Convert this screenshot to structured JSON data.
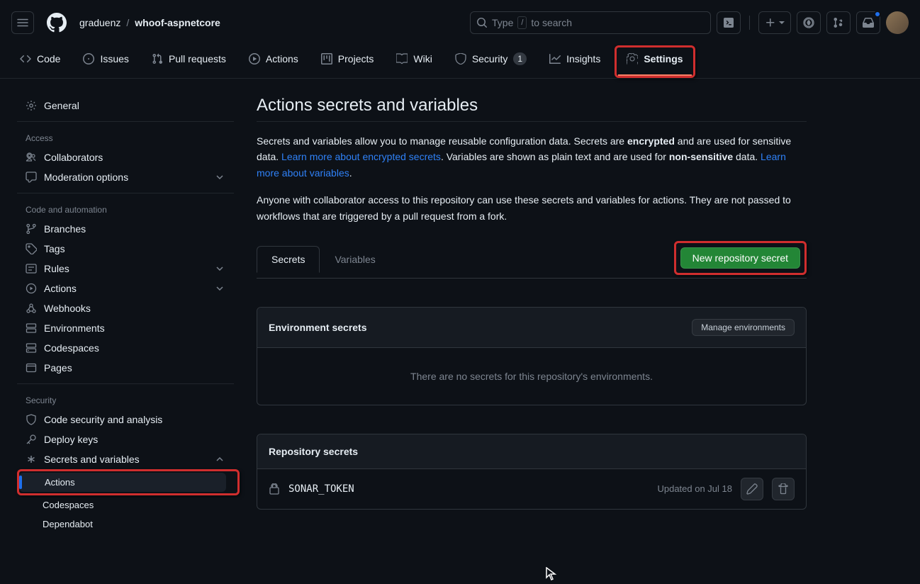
{
  "breadcrumb": {
    "owner": "graduenz",
    "repo": "whoof-aspnetcore"
  },
  "search": {
    "prefix": "Type",
    "key": "/",
    "suffix": "to search"
  },
  "repoNav": {
    "code": "Code",
    "issues": "Issues",
    "pulls": "Pull requests",
    "actions": "Actions",
    "projects": "Projects",
    "wiki": "Wiki",
    "security": "Security",
    "securityCount": "1",
    "insights": "Insights",
    "settings": "Settings"
  },
  "sidebar": {
    "general": "General",
    "accessHeading": "Access",
    "collaborators": "Collaborators",
    "moderation": "Moderation options",
    "codeHeading": "Code and automation",
    "branches": "Branches",
    "tags": "Tags",
    "rules": "Rules",
    "actions": "Actions",
    "webhooks": "Webhooks",
    "environments": "Environments",
    "codespaces": "Codespaces",
    "pages": "Pages",
    "securityHeading": "Security",
    "codeSecurity": "Code security and analysis",
    "deployKeys": "Deploy keys",
    "secretsVars": "Secrets and variables",
    "sub": {
      "actions": "Actions",
      "codespaces": "Codespaces",
      "dependabot": "Dependabot"
    }
  },
  "page": {
    "title": "Actions secrets and variables",
    "desc1a": "Secrets and variables allow you to manage reusable configuration data. Secrets are ",
    "desc1b": "encrypted",
    "desc1c": " and are used for sensitive data. ",
    "link1": "Learn more about encrypted secrets",
    "desc1d": ". Variables are shown as plain text and are used for ",
    "desc1e": "non-sensitive",
    "desc1f": " data. ",
    "link2": "Learn more about variables",
    "desc1g": ".",
    "desc2": "Anyone with collaborator access to this repository can use these secrets and variables for actions. They are not passed to workflows that are triggered by a pull request from a fork.",
    "tabs": {
      "secrets": "Secrets",
      "variables": "Variables"
    },
    "newSecret": "New repository secret",
    "envSecrets": {
      "title": "Environment secrets",
      "manage": "Manage environments",
      "empty": "There are no secrets for this repository's environments."
    },
    "repoSecrets": {
      "title": "Repository secrets",
      "items": [
        {
          "name": "SONAR_TOKEN",
          "updated": "Updated on Jul 18"
        }
      ]
    }
  }
}
